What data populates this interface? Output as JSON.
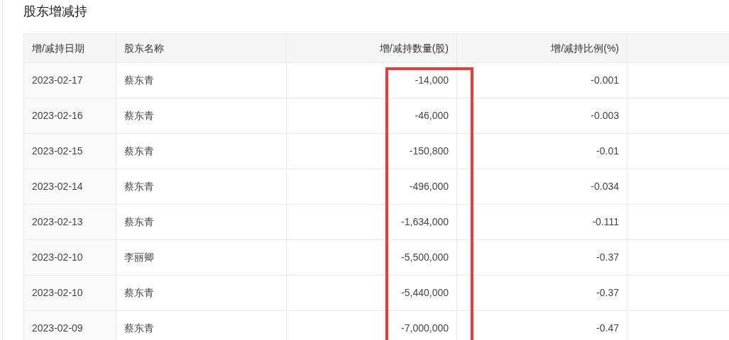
{
  "title": "股东增减持",
  "table": {
    "columns": [
      "增/减持日期",
      "股东名称",
      "增/减持数量(股)",
      "增/减持比例(%)"
    ],
    "rows": [
      {
        "cells": [
          "2023-02-17",
          "蔡东青",
          "-14,000",
          "-0.001"
        ]
      },
      {
        "cells": [
          "2023-02-16",
          "蔡东青",
          "-46,000",
          "-0.003"
        ]
      },
      {
        "cells": [
          "2023-02-15",
          "蔡东青",
          "-150,800",
          "-0.01"
        ]
      },
      {
        "cells": [
          "2023-02-14",
          "蔡东青",
          "-496,000",
          "-0.034"
        ]
      },
      {
        "cells": [
          "2023-02-13",
          "蔡东青",
          "-1,634,000",
          "-0.111"
        ]
      },
      {
        "cells": [
          "2023-02-10",
          "李丽卿",
          "-5,500,000",
          "-0.37"
        ]
      },
      {
        "cells": [
          "2023-02-10",
          "蔡东青",
          "-5,440,000",
          "-0.37"
        ]
      },
      {
        "cells": [
          "2023-02-09",
          "蔡东青",
          "-7,000,000",
          "-0.47"
        ]
      }
    ]
  }
}
